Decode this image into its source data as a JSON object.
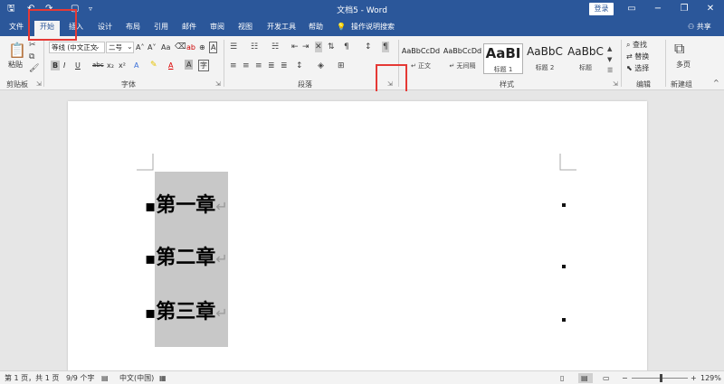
{
  "window": {
    "title": "文档5 - Word",
    "login": "登录",
    "qat_icons": [
      "save-icon",
      "undo-icon",
      "redo-icon",
      "customize-icon"
    ],
    "controls": [
      "▭",
      "−",
      "❐",
      "✕"
    ]
  },
  "tabs": [
    {
      "label": "文件"
    },
    {
      "label": "开始"
    },
    {
      "label": "插入"
    },
    {
      "label": "设计"
    },
    {
      "label": "布局"
    },
    {
      "label": "引用"
    },
    {
      "label": "邮件"
    },
    {
      "label": "审阅"
    },
    {
      "label": "视图"
    },
    {
      "label": "开发工具"
    },
    {
      "label": "帮助"
    },
    {
      "label": "操作说明搜索"
    }
  ],
  "share": "共享",
  "ribbon": {
    "clipboard": {
      "paste": "粘贴",
      "label": "剪贴板"
    },
    "font": {
      "name": "等线 (中文正文",
      "size": "二号",
      "label": "字体",
      "buttons": [
        "B",
        "I",
        "U",
        "abc",
        "x₂",
        "x²",
        "A",
        "A"
      ],
      "size_buttons": [
        "A˄",
        "A˅",
        "Aa",
        "A"
      ]
    },
    "paragraph": {
      "label": "段落"
    },
    "styles": {
      "label": "样式",
      "items": [
        {
          "preview": "AaBbCcDd",
          "name": "↵ 正文"
        },
        {
          "preview": "AaBbCcDd",
          "name": "↵ 无间隔"
        },
        {
          "preview": "AaBI",
          "name": "标题 1"
        },
        {
          "preview": "AaBbC",
          "name": "标题 2"
        },
        {
          "preview": "AaBbC",
          "name": "标题"
        }
      ]
    },
    "editing": {
      "find": "查找",
      "replace": "替换",
      "select": "选择",
      "label": "编辑"
    },
    "new_group": {
      "button": "多页",
      "label": "新建组"
    }
  },
  "document": {
    "headings": [
      "第一章",
      "第二章",
      "第三章"
    ],
    "para_mark": "↵"
  },
  "status": {
    "page": "第 1 页，共 1 页",
    "words": "9/9 个字",
    "language": "中文(中国)",
    "zoom": "129%"
  }
}
